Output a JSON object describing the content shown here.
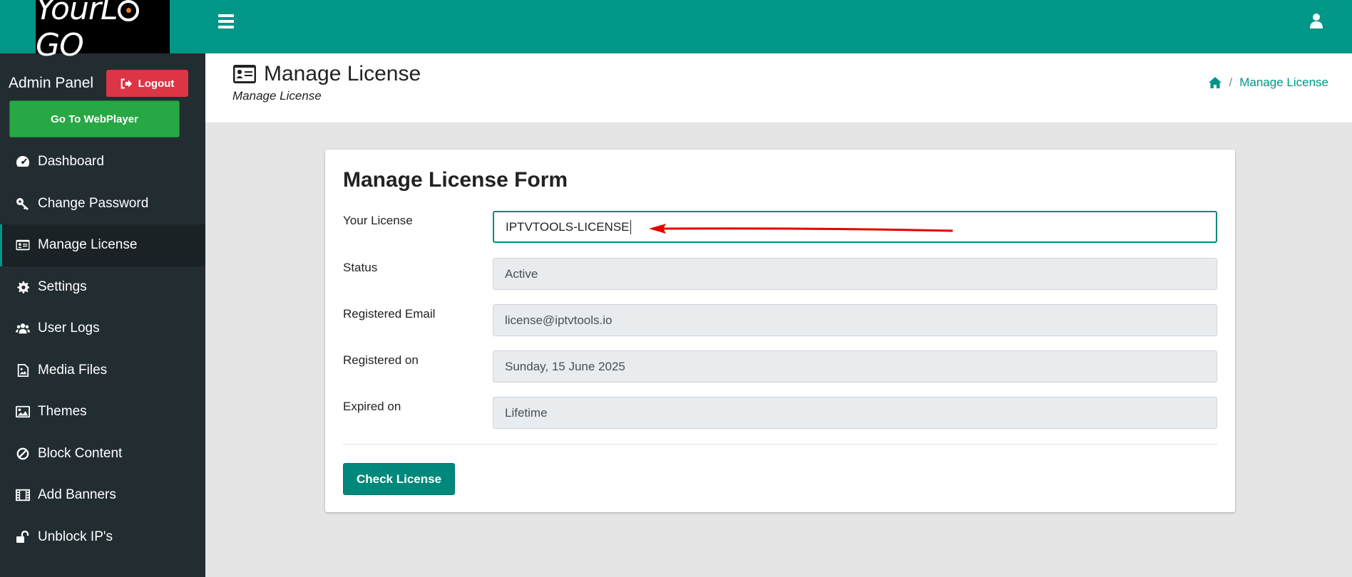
{
  "sidebar": {
    "logo_text_a": "Your",
    "logo_text_b": "L",
    "logo_text_c": "GO",
    "admin_label": "Admin Panel",
    "logout_label": "Logout",
    "webplayer_label": "Go To WebPlayer",
    "items": [
      {
        "label": "Dashboard",
        "icon": "dashboard-icon"
      },
      {
        "label": "Change Password",
        "icon": "key-icon"
      },
      {
        "label": "Manage License",
        "icon": "id-card-icon",
        "active": true
      },
      {
        "label": "Settings",
        "icon": "gear-icon"
      },
      {
        "label": "User Logs",
        "icon": "users-icon"
      },
      {
        "label": "Media Files",
        "icon": "file-image-icon"
      },
      {
        "label": "Themes",
        "icon": "image-icon"
      },
      {
        "label": "Block Content",
        "icon": "ban-icon"
      },
      {
        "label": "Add Banners",
        "icon": "film-icon"
      },
      {
        "label": "Unblock IP's",
        "icon": "unlock-icon"
      }
    ]
  },
  "header": {
    "page_title": "Manage License",
    "page_subtitle": "Manage License",
    "breadcrumb_current": "Manage License",
    "breadcrumb_separator": "/"
  },
  "form": {
    "title": "Manage License Form",
    "fields": [
      {
        "label": "Your License",
        "value": "IPTVTOOLS-LICENSE",
        "editable": true
      },
      {
        "label": "Status",
        "value": "Active",
        "editable": false
      },
      {
        "label": "Registered Email",
        "value": "license@iptvtools.io",
        "editable": false
      },
      {
        "label": "Registered on",
        "value": "Sunday, 15 June 2025",
        "editable": false
      },
      {
        "label": "Expired on",
        "value": "Lifetime",
        "editable": false
      }
    ],
    "submit_label": "Check License"
  },
  "colors": {
    "primary": "#009688",
    "sidebar_bg": "#222d32",
    "logout": "#dc3545",
    "webplayer": "#28a745",
    "arrow": "#e60000"
  }
}
